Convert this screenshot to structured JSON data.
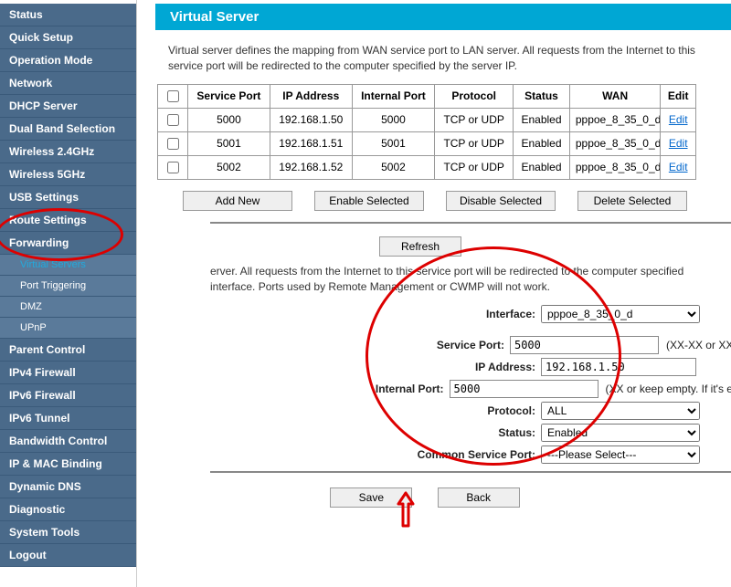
{
  "sidebar": {
    "items": [
      {
        "label": "Status"
      },
      {
        "label": "Quick Setup"
      },
      {
        "label": "Operation Mode"
      },
      {
        "label": "Network"
      },
      {
        "label": "DHCP Server"
      },
      {
        "label": "Dual Band Selection"
      },
      {
        "label": "Wireless 2.4GHz"
      },
      {
        "label": "Wireless 5GHz"
      },
      {
        "label": "USB Settings"
      },
      {
        "label": "Route Settings"
      },
      {
        "label": "Forwarding"
      },
      {
        "label": "Virtual Servers",
        "sub": true,
        "active": true
      },
      {
        "label": "Port Triggering",
        "sub": true
      },
      {
        "label": "DMZ",
        "sub": true
      },
      {
        "label": "UPnP",
        "sub": true
      },
      {
        "label": "Parent Control"
      },
      {
        "label": "IPv4 Firewall"
      },
      {
        "label": "IPv6 Firewall"
      },
      {
        "label": "IPv6 Tunnel"
      },
      {
        "label": "Bandwidth Control"
      },
      {
        "label": "IP & MAC Binding"
      },
      {
        "label": "Dynamic DNS"
      },
      {
        "label": "Diagnostic"
      },
      {
        "label": "System Tools"
      },
      {
        "label": "Logout"
      }
    ]
  },
  "page": {
    "title": "Virtual Server",
    "description": "Virtual server defines the mapping from WAN service port to LAN server. All requests from the Internet to this service port will be redirected to the computer specified by the server IP.",
    "description2": "erver. All requests from the Internet to this service port will be redirected to the computer specified interface. Ports used by Remote Management or CWMP will not work."
  },
  "table": {
    "headers": {
      "service_port": "Service Port",
      "ip_address": "IP Address",
      "internal_port": "Internal Port",
      "protocol": "Protocol",
      "status": "Status",
      "wan": "WAN",
      "edit": "Edit"
    },
    "rows": [
      {
        "service_port": "5000",
        "ip": "192.168.1.50",
        "internal_port": "5000",
        "protocol": "TCP or UDP",
        "status": "Enabled",
        "wan": "pppoe_8_35_0_d",
        "edit": "Edit"
      },
      {
        "service_port": "5001",
        "ip": "192.168.1.51",
        "internal_port": "5001",
        "protocol": "TCP or UDP",
        "status": "Enabled",
        "wan": "pppoe_8_35_0_d",
        "edit": "Edit"
      },
      {
        "service_port": "5002",
        "ip": "192.168.1.52",
        "internal_port": "5002",
        "protocol": "TCP or UDP",
        "status": "Enabled",
        "wan": "pppoe_8_35_0_d",
        "edit": "Edit"
      }
    ]
  },
  "buttons": {
    "add_new": "Add New",
    "enable_selected": "Enable Selected",
    "disable_selected": "Disable Selected",
    "delete_selected": "Delete Selected",
    "refresh": "Refresh",
    "save": "Save",
    "back": "Back"
  },
  "form": {
    "labels": {
      "interface": "Interface:",
      "service_port": "Service Port:",
      "ip_address": "IP Address:",
      "internal_port": "Internal Port:",
      "protocol": "Protocol:",
      "status": "Status:",
      "common_service_port": "Common Service Port:"
    },
    "values": {
      "interface": "pppoe_8_35_0_d",
      "service_port": "5000",
      "ip_address": "192.168.1.50",
      "internal_port": "5000",
      "protocol": "ALL",
      "status": "Enabled",
      "common_service_port": "---Please Select---"
    },
    "hints": {
      "service_port": "(XX-XX or XX)",
      "internal_port": "(XX or keep empty. If it's empty, In"
    }
  }
}
